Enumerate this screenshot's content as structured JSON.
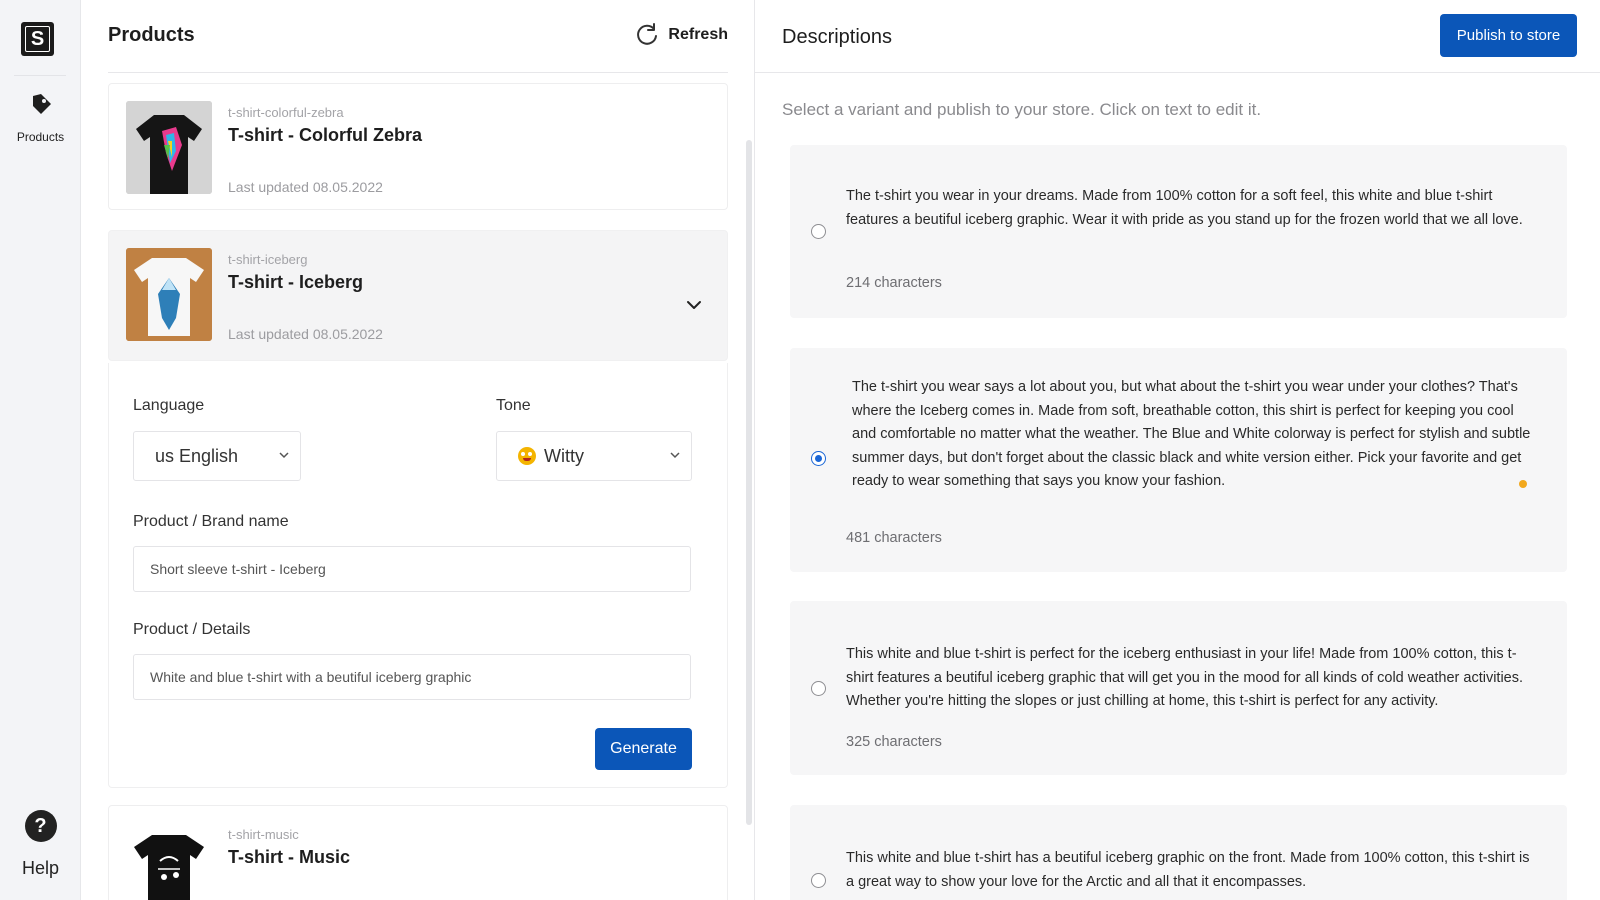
{
  "brand": {
    "logo_letter": "S"
  },
  "rail": {
    "products_label": "Products",
    "help_label": "Help",
    "help_glyph": "?"
  },
  "products": {
    "title": "Products",
    "refresh_label": "Refresh",
    "items": [
      {
        "slug": "t-shirt-colorful-zebra",
        "name": "T-shirt - Colorful Zebra",
        "updated": "Last updated 08.05.2022"
      },
      {
        "slug": "t-shirt-iceberg",
        "name": "T-shirt - Iceberg",
        "updated": "Last updated 08.05.2022"
      },
      {
        "slug": "t-shirt-music",
        "name": "T-shirt - Music",
        "updated": ""
      }
    ]
  },
  "form": {
    "language_label": "Language",
    "language_value": "us English",
    "tone_label": "Tone",
    "tone_value": "Witty",
    "brand_label": "Product / Brand name",
    "brand_value": "Short sleeve t-shirt - Iceberg",
    "details_label": "Product / Details",
    "details_value": "White and blue t-shirt with a beutiful iceberg graphic",
    "generate_label": "Generate"
  },
  "descriptions": {
    "title": "Descriptions",
    "publish_label": "Publish to store",
    "hint": "Select a variant and publish to your store. Click on text to edit it.",
    "variants": [
      {
        "text": "The t-shirt you wear in your dreams. Made from 100% cotton for a soft feel, this white and blue t-shirt features a beutiful iceberg graphic. Wear it with pride as you stand up for the frozen world that we all love.",
        "count": "214 characters",
        "selected": false
      },
      {
        "text": "The t-shirt you wear says a lot about you, but what about the t-shirt you wear under your clothes? That's where the Iceberg comes in. Made from soft, breathable cotton, this shirt is perfect for keeping you cool and comfortable no matter what the weather. The Blue and White colorway is perfect for stylish and subtle summer days, but don't forget about the classic black and white version either. Pick your favorite and get ready to wear something that says you know your fashion.",
        "count": "481 characters",
        "selected": true
      },
      {
        "text": "This white and blue t-shirt is perfect for the iceberg enthusiast in your life! Made from 100% cotton, this t-shirt features a beutiful iceberg graphic that will get you in the mood for all kinds of cold weather activities. Whether you're hitting the slopes or just chilling at home, this t-shirt is perfect for any activity.",
        "count": "325 characters",
        "selected": false
      },
      {
        "text": "This white and blue t-shirt has a beutiful iceberg graphic on the front. Made from 100% cotton, this t-shirt is a great way to show your love for the Arctic and all that it encompasses.",
        "count": "",
        "selected": false
      }
    ]
  },
  "colors": {
    "primary": "#0b56b8",
    "radio_selected": "#1a66d6",
    "accent_dot": "#f2a81d"
  },
  "icons": [
    "tag-icon",
    "refresh-icon",
    "chevron-down-icon",
    "help-icon",
    "emoji-icon"
  ]
}
